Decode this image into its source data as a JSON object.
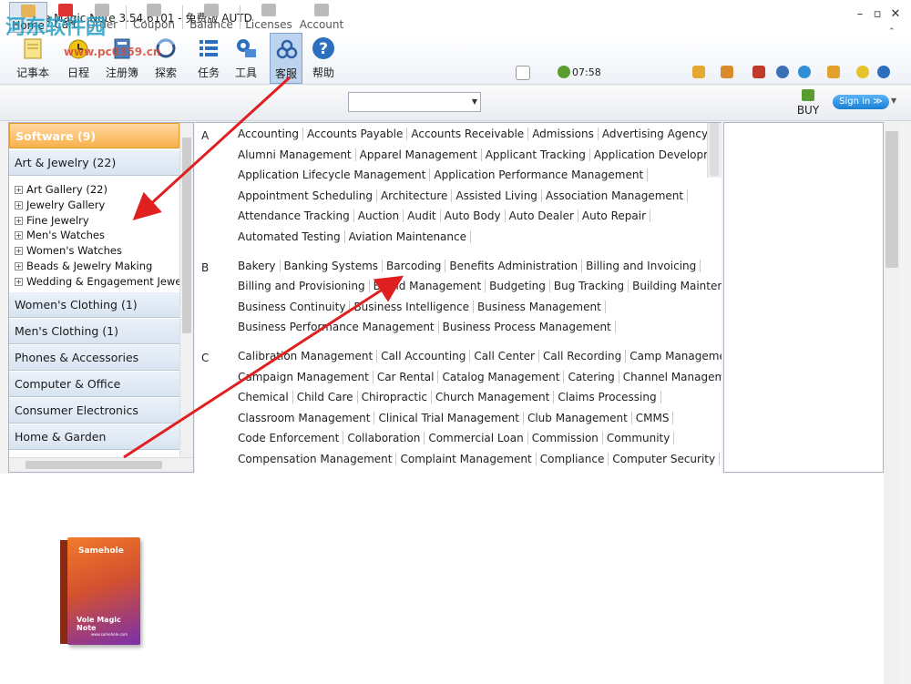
{
  "window": {
    "title": "Vole Magic Note 3.54.6101 - 免费版 AUTD",
    "min": "–",
    "max": "▫",
    "close": "✕"
  },
  "watermark": {
    "site": "河东软件园",
    "url": "www.pc0359.cn"
  },
  "toolbar": {
    "items": [
      {
        "label": "记事本",
        "icon": "notepad-icon"
      },
      {
        "label": "日程",
        "icon": "calendar-icon"
      },
      {
        "label": "注册簿",
        "icon": "registry-icon"
      },
      {
        "label": "探索",
        "icon": "explore-icon"
      },
      {
        "label": "任务",
        "icon": "task-list-icon"
      },
      {
        "label": "工具",
        "icon": "tools-icon"
      },
      {
        "label": "客服",
        "icon": "support-icon",
        "active": true
      },
      {
        "label": "帮助",
        "icon": "help-icon"
      }
    ],
    "time": "07:58"
  },
  "shopbar": {
    "items": [
      {
        "label": "Home",
        "icon": "home-icon"
      },
      {
        "label": "Cart",
        "icon": "cart-icon"
      },
      {
        "label": "Order",
        "icon": "order-icon"
      },
      {
        "label": "Coupon",
        "icon": "coupon-icon"
      },
      {
        "label": "Balance",
        "icon": "balance-icon"
      },
      {
        "label": "Licenses",
        "icon": "licenses-icon"
      },
      {
        "label": "Account",
        "icon": "account-icon"
      }
    ],
    "buy": "BUY",
    "sign_in": "Sign in ≫"
  },
  "categories": {
    "software": "Software (9)",
    "art_jewelry": "Art & Jewelry (22)",
    "subitems": [
      "Art Gallery (22)",
      "Jewelry Gallery",
      "Fine Jewelry",
      "Men's Watches",
      "Women's Watches",
      "Beads & Jewelry Making",
      "Wedding & Engagement Jewe"
    ],
    "rest": [
      "Women's Clothing (1)",
      "Men's Clothing (1)",
      "Phones & Accessories",
      "Computer & Office",
      "Consumer Electronics",
      "Home & Garden"
    ]
  },
  "directory": {
    "A": [
      [
        "Accounting",
        "Accounts Payable",
        "Accounts Receivable",
        "Admissions",
        "Advertising Agency"
      ],
      [
        "Alumni Management",
        "Apparel Management",
        "Applicant Tracking",
        "Application Development"
      ],
      [
        "Application Lifecycle Management",
        "Application Performance Management"
      ],
      [
        "Appointment Scheduling",
        "Architecture",
        "Assisted Living",
        "Association Management"
      ],
      [
        "Attendance Tracking",
        "Auction",
        "Audit",
        "Auto Body",
        "Auto Dealer",
        "Auto Repair"
      ],
      [
        "Automated Testing",
        "Aviation Maintenance"
      ]
    ],
    "B": [
      [
        "Bakery",
        "Banking Systems",
        "Barcoding",
        "Benefits Administration",
        "Billing and Invoicing"
      ],
      [
        "Billing and Provisioning",
        "Brand Management",
        "Budgeting",
        "Bug Tracking",
        "Building Maintenance"
      ],
      [
        "Business Continuity",
        "Business Intelligence",
        "Business Management"
      ],
      [
        "Business Performance Management",
        "Business Process Management"
      ]
    ],
    "C": [
      [
        "Calibration Management",
        "Call Accounting",
        "Call Center",
        "Call Recording",
        "Camp Management"
      ],
      [
        "Campaign Management",
        "Car Rental",
        "Catalog Management",
        "Catering",
        "Channel Management"
      ],
      [
        "Chemical",
        "Child Care",
        "Chiropractic",
        "Church Management",
        "Claims Processing"
      ],
      [
        "Classroom Management",
        "Clinical Trial Management",
        "Club Management",
        "CMMS"
      ],
      [
        "Code Enforcement",
        "Collaboration",
        "Commercial Loan",
        "Commission",
        "Community"
      ],
      [
        "Compensation Management",
        "Complaint Management",
        "Compliance",
        "Computer Security"
      ]
    ]
  },
  "product": {
    "brand": "Samehole",
    "name": "Vole Magic Note",
    "url": "www.samehole.com"
  },
  "colors": {
    "accent_orange": "#f8b14a",
    "arrow_red": "#e02020",
    "signin_blue": "#1b7fd1"
  }
}
